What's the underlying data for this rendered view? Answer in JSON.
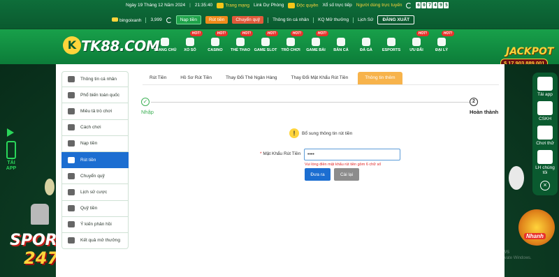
{
  "topbar": {
    "date": "Ngày 19 Tháng 12 Năm 2024",
    "time": "21:35:40",
    "links": [
      "Trang mạng",
      "Link Dự Phòng",
      "Độc quyền",
      "Xổ số trực tiếp",
      "Người dùng trực tuyến"
    ],
    "online_digits": [
      "6",
      "0",
      "7",
      "4",
      "9",
      "5"
    ],
    "username": "bingoixanh",
    "balance": "3,999",
    "btn_nap": "Nạp tiền",
    "btn_rut": "Rút tiền",
    "btn_chuyen": "Chuyển quỹ",
    "link_info": "Thông tin cá nhân",
    "link_kq": "KQ Mở thưởng",
    "link_history": "Lịch Sử",
    "logout": "ĐĂNG XUẤT"
  },
  "nav": {
    "logo_letter": "K",
    "logo_text": "TK88.COM",
    "items": [
      {
        "label": "TRANG CHỦ",
        "hot": ""
      },
      {
        "label": "XỔ SỐ",
        "hot": "HOT!"
      },
      {
        "label": "CASINO",
        "hot": "HOT!"
      },
      {
        "label": "THỂ THAO",
        "hot": "HOT!"
      },
      {
        "label": "GAME SLOT",
        "hot": "HOT!"
      },
      {
        "label": "TRÒ CHƠI",
        "hot": "HOT!"
      },
      {
        "label": "GAME BÀI",
        "hot": "HOT!"
      },
      {
        "label": "BẮN CÁ",
        "hot": ""
      },
      {
        "label": "ĐÁ GÀ",
        "hot": ""
      },
      {
        "label": "ESPORTS",
        "hot": ""
      },
      {
        "label": "ƯU ĐÃI",
        "hot": "HOT!"
      },
      {
        "label": "ĐẠI LÝ",
        "hot": "HOT!"
      }
    ],
    "jackpot_title": "JACKPOT",
    "jackpot_value": "$ 17,903,889,001"
  },
  "sidebar": {
    "items": [
      {
        "label": "Thông tin cá nhân",
        "icon": "id-card-icon"
      },
      {
        "label": "Phổ biến toàn quốc",
        "icon": "share-icon"
      },
      {
        "label": "Miêu tả trò chơi",
        "icon": "gamepad-icon"
      },
      {
        "label": "Cách chơi",
        "icon": "info-icon"
      },
      {
        "label": "Nạp tiền",
        "icon": "deposit-icon"
      },
      {
        "label": "Rút tiền",
        "icon": "bank-icon"
      },
      {
        "label": "Chuyển quỹ",
        "icon": "transfer-icon"
      },
      {
        "label": "Lịch sử cược",
        "icon": "history-icon"
      },
      {
        "label": "Quỹ tiền",
        "icon": "stopwatch-icon"
      },
      {
        "label": "Ý kiến phản hồi",
        "icon": "chat-icon"
      },
      {
        "label": "Kết quả mở thưởng",
        "icon": "results-icon"
      }
    ],
    "active_index": 5
  },
  "tabs": {
    "items": [
      "Rút Tiền",
      "Hồ Sơ Rút Tiền",
      "Thay Đổi Thẻ Ngân Hàng",
      "Thay Đổi Mật Khẩu Rút Tiền",
      "Thông tin thêm"
    ],
    "active_index": 4
  },
  "steps": {
    "step1_label": "Nhập",
    "step2_number": "2",
    "step2_label": "Hoàn thành"
  },
  "notice": "Bổ sung thông tin rút tiền",
  "form": {
    "label_required": "*",
    "label": "Mật Khẩu Rút Tiền",
    "password_value": "••••",
    "error": "Vui lòng điền mật khẩu rút tiền gồm 6 chữ số",
    "submit": "Đưa ra",
    "reset": "Cài lại"
  },
  "right_panel": {
    "items": [
      "Tải app",
      "CSKH",
      "Chơi thử",
      "LH chúng tôi"
    ]
  },
  "side_left_label": "TẢI APP",
  "promo": {
    "sport_line1": "SPORT",
    "sport_line2": "247",
    "wheel_label": "Nhanh"
  },
  "watermark": {
    "line1": "Activate Windows",
    "line2": "Go to Settings to activate Windows."
  },
  "colors": {
    "brand_green": "#0e6e3a",
    "active_blue": "#1c6ed1",
    "tab_orange": "#f7b34b",
    "error_red": "#e02424",
    "step_green": "#3cb054"
  }
}
